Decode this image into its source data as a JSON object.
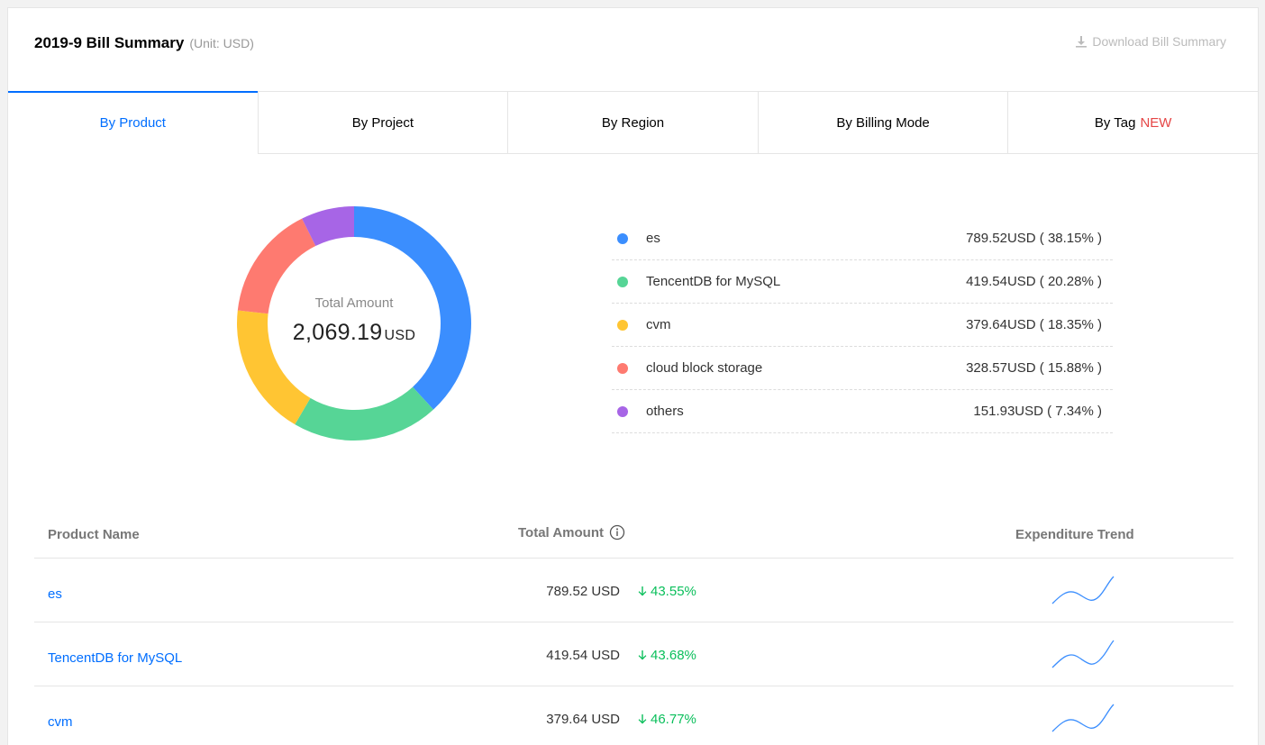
{
  "header": {
    "title": "2019-9 Bill Summary",
    "unit": "(Unit: USD)",
    "download_label": "Download Bill Summary"
  },
  "tabs": [
    {
      "label": "By Product",
      "active": true
    },
    {
      "label": "By Project"
    },
    {
      "label": "By Region"
    },
    {
      "label": "By Billing Mode"
    },
    {
      "label": "By Tag",
      "badge": "NEW"
    }
  ],
  "donut": {
    "center_label": "Total Amount",
    "total_value": "2,069.19",
    "total_unit": "USD"
  },
  "legend": [
    {
      "name": "es",
      "value": "789.52USD ( 38.15% )",
      "color": "#3b8efe"
    },
    {
      "name": "TencentDB for MySQL",
      "value": "419.54USD ( 20.28% )",
      "color": "#56d596"
    },
    {
      "name": "cvm",
      "value": "379.64USD ( 18.35% )",
      "color": "#ffc533"
    },
    {
      "name": "cloud block storage",
      "value": "328.57USD ( 15.88% )",
      "color": "#fe7a70"
    },
    {
      "name": "others",
      "value": "151.93USD ( 7.34% )",
      "color": "#a765e6"
    }
  ],
  "chart_data": {
    "type": "pie",
    "categories": [
      "es",
      "TencentDB for MySQL",
      "cvm",
      "cloud block storage",
      "others"
    ],
    "values": [
      789.52,
      419.54,
      379.64,
      328.57,
      151.93
    ],
    "percentages": [
      38.15,
      20.28,
      18.35,
      15.88,
      7.34
    ],
    "colors": [
      "#3b8efe",
      "#56d596",
      "#ffc533",
      "#fe7a70",
      "#a765e6"
    ],
    "title": ""
  },
  "table": {
    "headers": {
      "name": "Product Name",
      "amount": "Total Amount",
      "trend": "Expenditure Trend"
    },
    "rows": [
      {
        "name": "es",
        "amount": "789.52 USD",
        "change": "43.55%"
      },
      {
        "name": "TencentDB for MySQL",
        "amount": "419.54 USD",
        "change": "43.68%"
      },
      {
        "name": "cvm",
        "amount": "379.64 USD",
        "change": "46.77%"
      }
    ]
  },
  "colors": {
    "accent": "#006eff",
    "new_badge": "#e54545",
    "decrease": "#0abf5b"
  }
}
